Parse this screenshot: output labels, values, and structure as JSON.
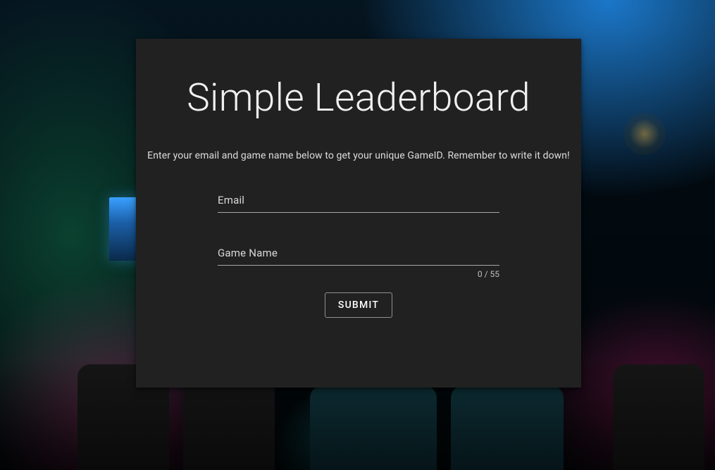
{
  "title": "Simple Leaderboard",
  "subtitle": "Enter your email and game name below to get your unique GameID. Remember to write it down!",
  "form": {
    "email": {
      "label": "Email",
      "value": ""
    },
    "gameName": {
      "label": "Game Name",
      "value": "",
      "counter": "0 / 55"
    },
    "submitLabel": "SUBMIT"
  }
}
